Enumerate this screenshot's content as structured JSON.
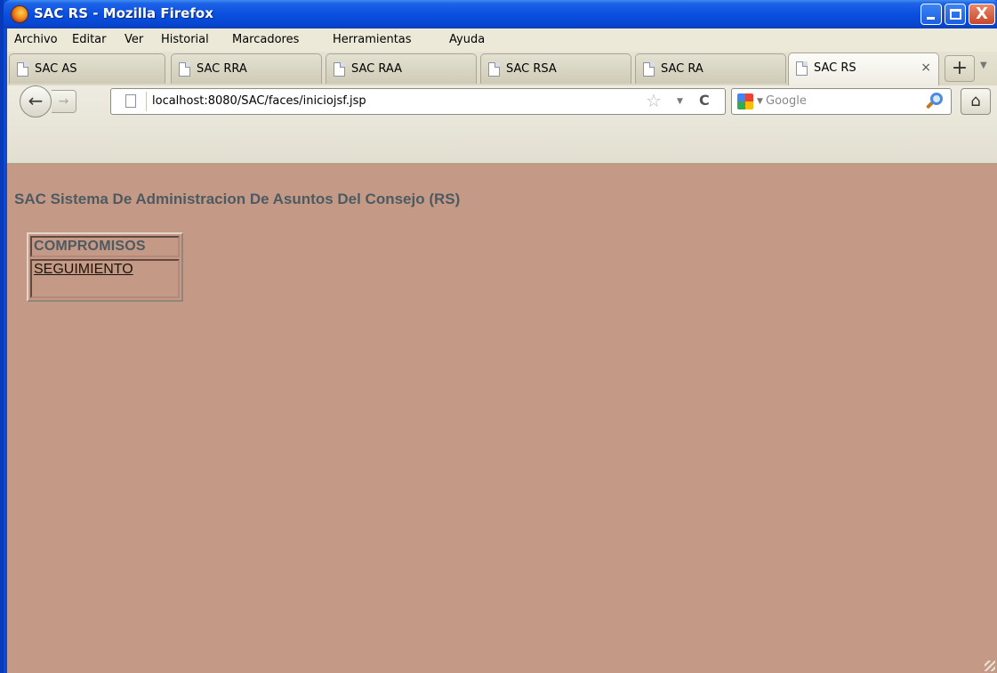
{
  "window": {
    "title": "SAC RS - Mozilla Firefox",
    "controls": {
      "close_glyph": "X"
    }
  },
  "menubar": {
    "items": [
      "Archivo",
      "Editar",
      "Ver",
      "Historial",
      "Marcadores",
      "Herramientas",
      "Ayuda"
    ]
  },
  "tabs": [
    {
      "label": "SAC AS",
      "active": false
    },
    {
      "label": "SAC RRA",
      "active": false
    },
    {
      "label": "SAC RAA",
      "active": false
    },
    {
      "label": "SAC RSA",
      "active": false
    },
    {
      "label": "SAC RA",
      "active": false
    },
    {
      "label": "SAC RS",
      "active": true
    }
  ],
  "tab_controls": {
    "close": "×",
    "new_tab": "+",
    "list": "▼"
  },
  "navbar": {
    "back_glyph": "←",
    "forward_glyph": "→",
    "url": "localhost:8080/SAC/faces/iniciojsf.jsp",
    "bookmark_glyph": "☆",
    "url_dropdown": "▼",
    "reload_glyph": "C",
    "search_placeholder": "Google",
    "search_dropdown": "▼",
    "home_glyph": "⌂"
  },
  "page": {
    "heading": "SAC Sistema De Administracion De Asuntos Del Consejo (RS)",
    "menu": {
      "header": "COMPROMISOS",
      "link": "SEGUIMIENTO"
    }
  },
  "colors": {
    "page_background": "#c49a87",
    "heading_text": "#4d5a62",
    "titlebar": "#0a4fe0"
  },
  "icons": [
    "firefox-logo-icon",
    "page-icon",
    "star-icon",
    "reload-icon",
    "google-icon",
    "magnifier-icon",
    "home-icon"
  ]
}
